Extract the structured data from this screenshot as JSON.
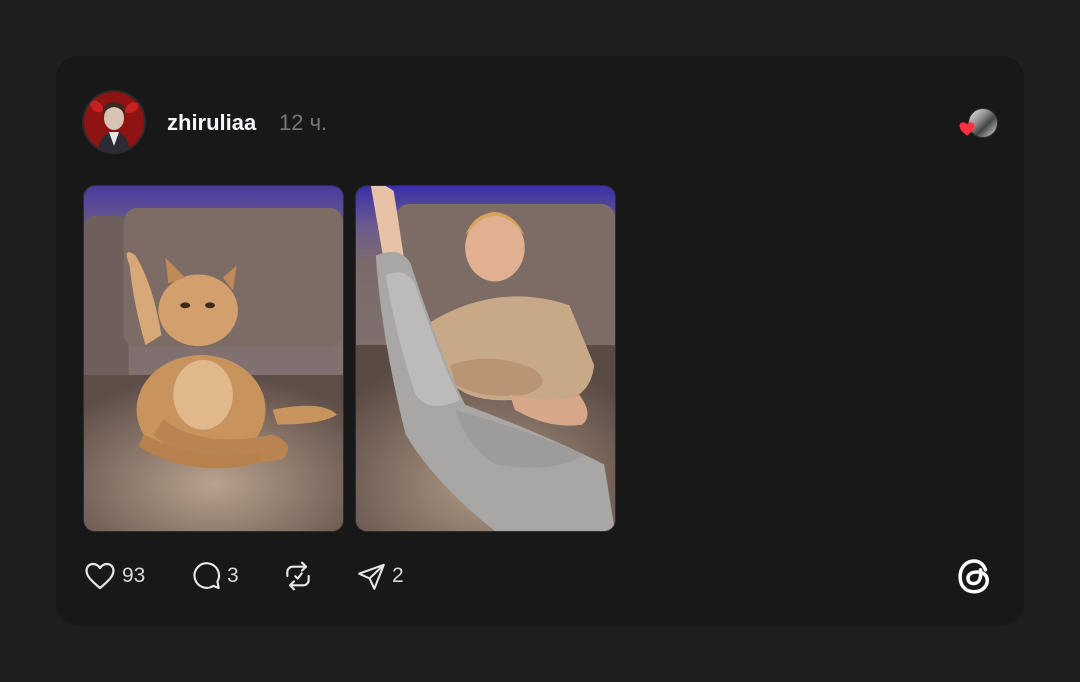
{
  "post": {
    "username": "zhiruliaa",
    "time": "12 ч.",
    "images": [
      {
        "name": "cat-photo",
        "subject": "cat"
      },
      {
        "name": "man-photo",
        "subject": "man"
      }
    ]
  },
  "actions": {
    "likes": "93",
    "comments": "3",
    "shares": "2"
  },
  "icons": {
    "like": "heart-icon",
    "comment": "comment-bubble-icon",
    "repost": "repost-icon",
    "share": "send-icon",
    "brand": "threads-logo-icon",
    "liked_badge": "red-heart-icon"
  },
  "colors": {
    "background": "#1e1e1e",
    "card": "#181818",
    "text": "#f3f5f7",
    "muted": "#777777",
    "heart": "#ff3040"
  }
}
